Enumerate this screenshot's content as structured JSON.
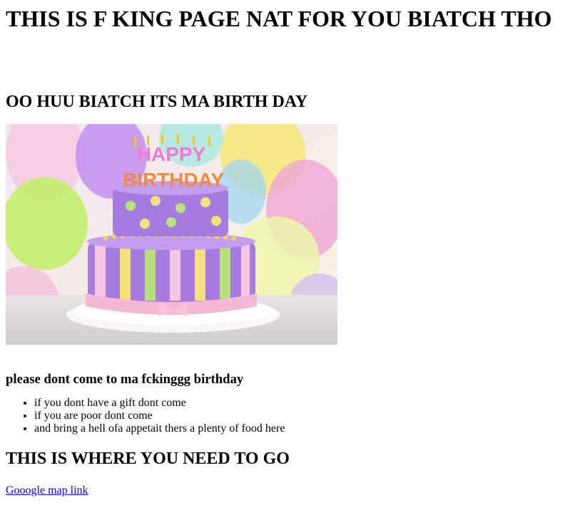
{
  "main_heading": "THIS IS F KING PAGE NAT FOR YOU BIATCH THO",
  "birthday_heading": "OO HUU BIATCH ITS MA BIRTH DAY",
  "image": {
    "icon": "birthday-cake-image",
    "cake_text_top": "HAPPY",
    "cake_text_bottom": "BIRTHDAY"
  },
  "notice_heading": "please dont come to ma fckinggg birthday",
  "rules": [
    "if you dont have a gift dont come",
    "if you are poor dont come",
    "and bring a hell ofa appetait thers a plenty of food here"
  ],
  "directions_heading": "THIS IS WHERE YOU NEED TO GO",
  "map_link": {
    "label": "Gooogle map link"
  },
  "colors": {
    "link": "#0000ee",
    "text": "#000000",
    "background": "#ffffff"
  }
}
